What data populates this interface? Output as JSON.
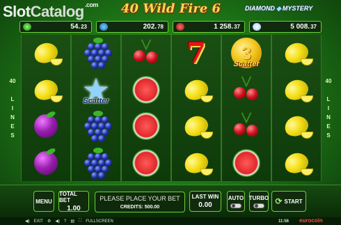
{
  "watermark": {
    "slot": "Slot",
    "catalog": "Catalog",
    "com": ".com"
  },
  "title": "40 Wild Fire 6",
  "diamond_logo": {
    "left": "DIAMOND",
    "right": "MYSTERY"
  },
  "jackpots": [
    {
      "icon": "green-gem-icon",
      "value": "54.",
      "dec": "23"
    },
    {
      "icon": "blue-gem-icon",
      "value": "202.",
      "dec": "78"
    },
    {
      "icon": "red-gem-icon",
      "value": "1 258.",
      "dec": "37"
    },
    {
      "icon": "diamond-icon",
      "value": "5 008.",
      "dec": "37"
    }
  ],
  "side_lines": {
    "number": "40",
    "word": "LINES"
  },
  "reels": [
    [
      "lemon",
      "lemon",
      "plum",
      "plum"
    ],
    [
      "grapes",
      "star-scatter",
      "grapes",
      "grapes"
    ],
    [
      "cherries",
      "watermelon",
      "watermelon",
      "watermelon"
    ],
    [
      "seven",
      "lemon",
      "lemon",
      "lemon"
    ],
    [
      "coin-scatter",
      "cherries",
      "cherries",
      "watermelon"
    ],
    [
      "lemon",
      "lemon",
      "lemon",
      "lemon"
    ]
  ],
  "scatter_label": "Scatter",
  "coin_digit": "3",
  "seven_digit": "7",
  "bottom": {
    "menu": "MENU",
    "total_bet_label": "TOTAL BET",
    "total_bet_value": "1.00",
    "message": "PLEASE PLACE YOUR BET",
    "credits": "CREDITS: 500.00",
    "last_win_label": "LAST WIN",
    "last_win_value": "0.00",
    "auto": "AUTO",
    "turbo": "TURBO",
    "start": "START"
  },
  "footer": {
    "exit": "EXIT",
    "fullscreen": "FULLSCREEN",
    "clock": "11:56",
    "brand": "eurocoin"
  }
}
